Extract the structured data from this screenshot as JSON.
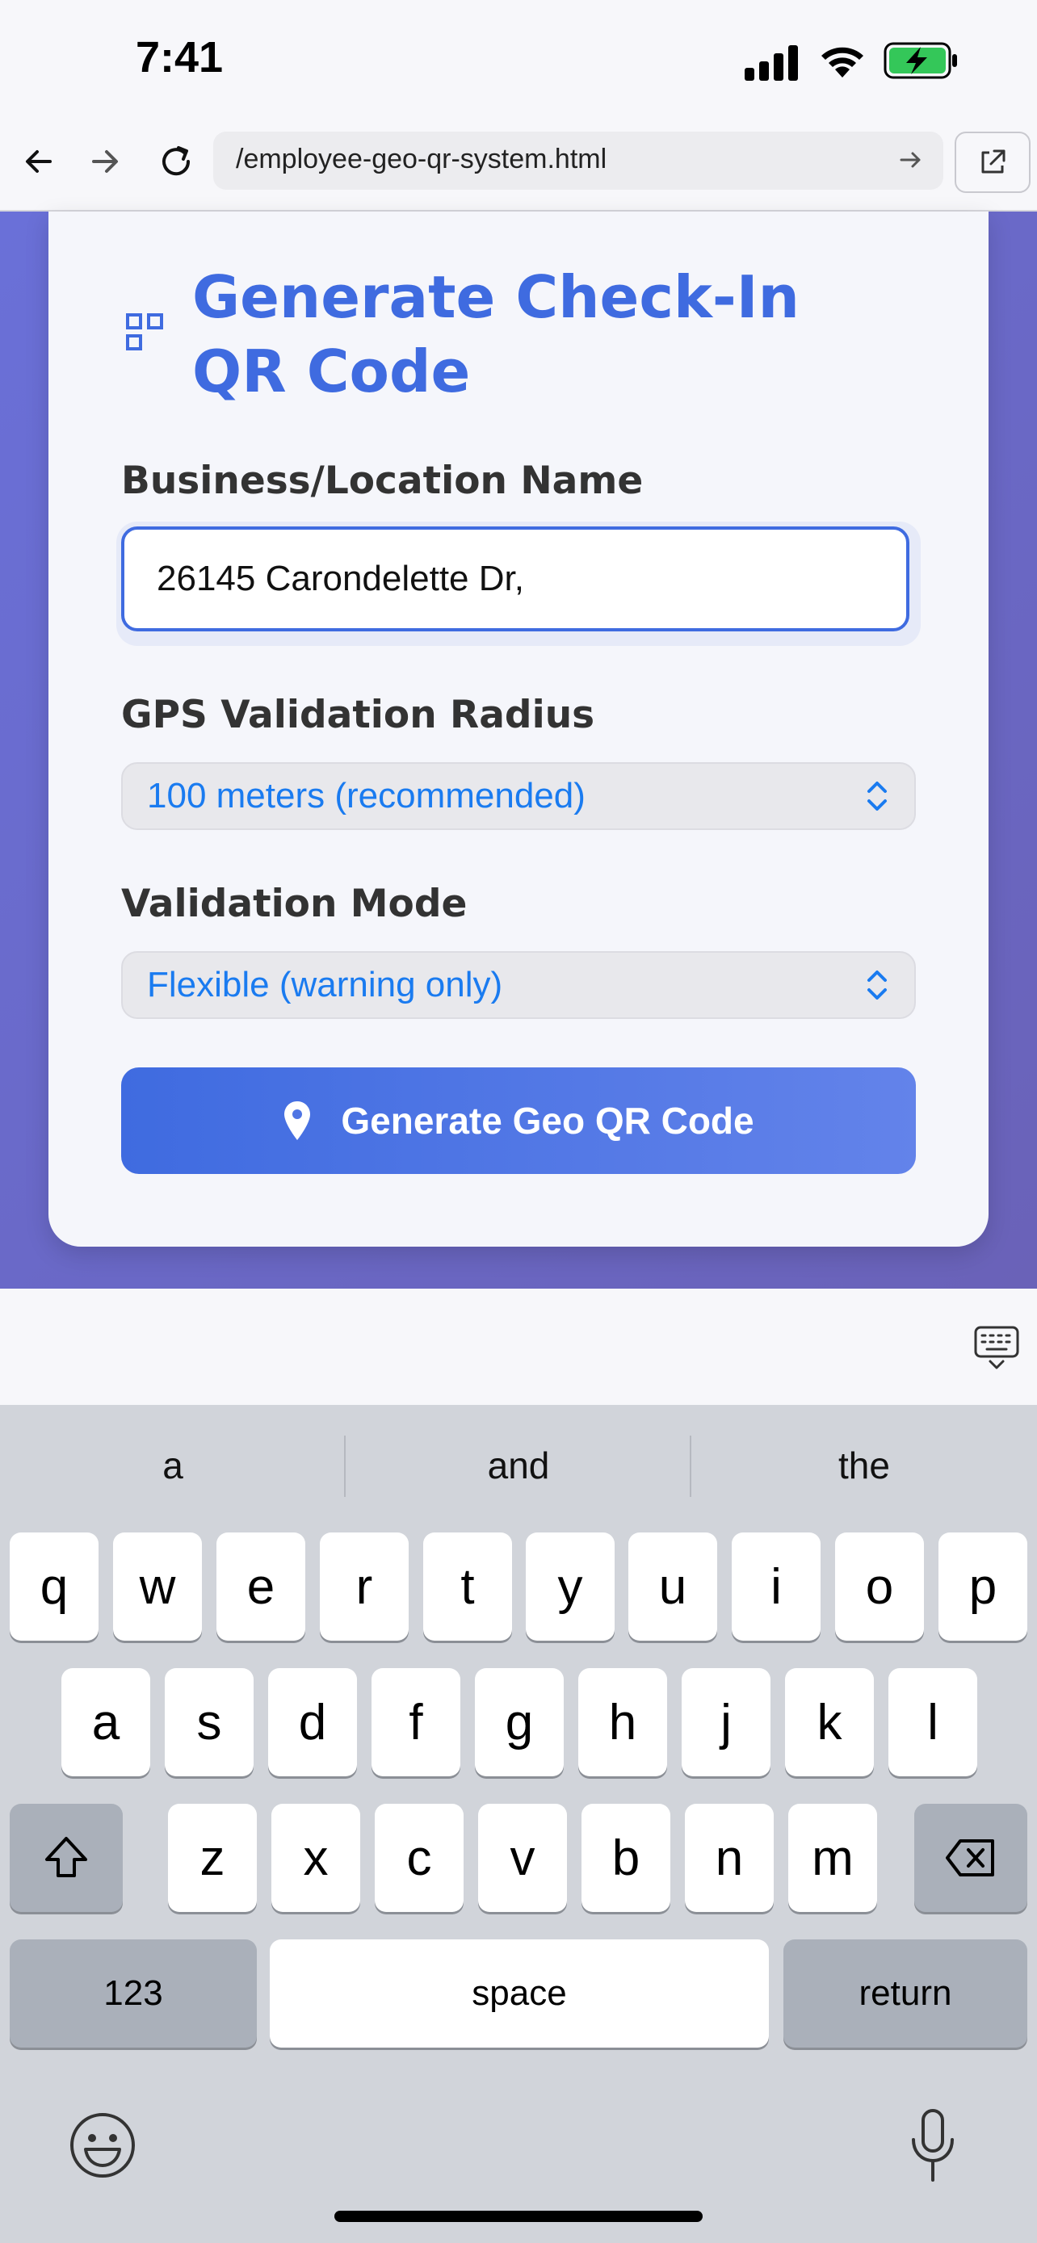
{
  "status_bar": {
    "time": "7:41",
    "icons": [
      "signal-icon",
      "wifi-icon",
      "battery-charging-icon"
    ]
  },
  "browser": {
    "url": "/employee-geo-qr-system.html",
    "buttons": [
      "back-icon",
      "forward-icon",
      "reload-icon",
      "go-icon",
      "open-external-icon"
    ]
  },
  "form": {
    "title": "Generate Check-In QR Code",
    "title_line1": "Generate Check-In",
    "title_line2": "QR Code",
    "name_label": "Business/Location Name",
    "name_value": "26145 Carondelette Dr,",
    "radius_label": "GPS Validation Radius",
    "radius_value": "100 meters (recommended)",
    "mode_label": "Validation Mode",
    "mode_value": "Flexible (warning only)",
    "generate_label": "Generate Geo QR Code",
    "accent_color": "#3f6be0"
  },
  "keyboard": {
    "suggestions": [
      "a",
      "and",
      "the"
    ],
    "row1": [
      "q",
      "w",
      "e",
      "r",
      "t",
      "y",
      "u",
      "i",
      "o",
      "p"
    ],
    "row2": [
      "a",
      "s",
      "d",
      "f",
      "g",
      "h",
      "j",
      "k",
      "l"
    ],
    "row3": [
      "z",
      "x",
      "c",
      "v",
      "b",
      "n",
      "m"
    ],
    "numbers_key": "123",
    "space_key": "space",
    "return_key": "return"
  }
}
